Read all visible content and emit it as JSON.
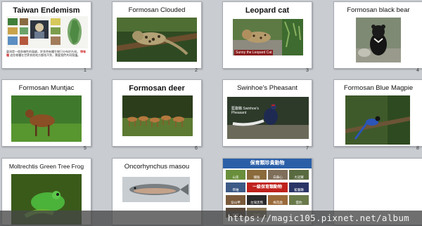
{
  "slides": [
    {
      "num": "1",
      "title": "Taiwan Endemism"
    },
    {
      "num": "2",
      "title": "Formosan Clouded"
    },
    {
      "num": "3",
      "title": "Leopard cat",
      "caption": "Sunny the Leopard Cat"
    },
    {
      "num": "4",
      "title": "Formosan black bear"
    },
    {
      "num": "5",
      "title": "Formosan Muntjac"
    },
    {
      "num": "6",
      "title": "Formosan deer"
    },
    {
      "num": "7",
      "title": "Swinhoe's Pheasant",
      "caption": "藍腹鷴 Swinhoe's Pheasant"
    },
    {
      "num": "8",
      "title": "Formosan Blue Magpie"
    },
    {
      "num": "",
      "title": "Moltrechtis Green Tree Frog"
    },
    {
      "num": "",
      "title": "Oncorhynchus masou"
    },
    {
      "num": "",
      "title": "",
      "poster_title": "保育類珍貴動物",
      "poster_banner": "一級保育類動物"
    }
  ],
  "slide1_text": {
    "line1": "臺灣是一個多樣性的島嶼，許多特有種生物只分布於台灣。",
    "highlight": "特有種",
    "line2": "這些物種在世界其他地方都找不到，需要我們共同保護。"
  },
  "poster_labels": [
    "山羌",
    "獼猴",
    "白鼻心",
    "大冠鷲",
    "帝雉",
    "藍腹鷴",
    "穿山甲",
    "台灣黑熊",
    "梅花鹿",
    "雲豹",
    "熊鷹",
    "石虎"
  ],
  "watermark": "https://magic105.pixnet.net/album",
  "colors": {
    "slide_bg": "#ffffff",
    "background": "#c9ccd1",
    "caption_red": "#8a1b1b",
    "poster_blue": "#2a5fa8"
  }
}
